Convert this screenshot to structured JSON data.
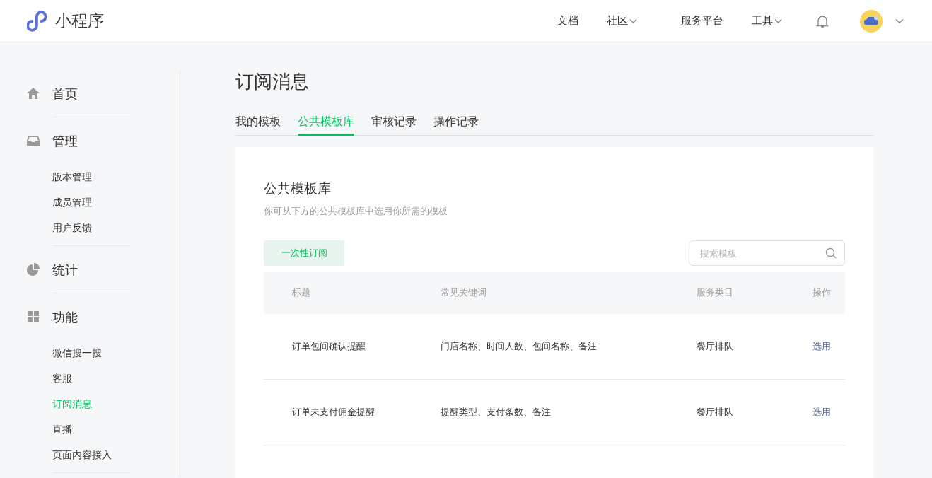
{
  "header": {
    "logo_text": "小程序",
    "nav": [
      {
        "label": "文档",
        "dropdown": false
      },
      {
        "label": "社区",
        "dropdown": true
      },
      {
        "label": "服务平台",
        "dropdown": false
      },
      {
        "label": "工具",
        "dropdown": true
      }
    ]
  },
  "sidebar": {
    "sections": [
      {
        "label": "首页",
        "kind": "home"
      },
      {
        "label": "管理",
        "kind": "inbox",
        "items": [
          {
            "label": "版本管理",
            "selected": false
          },
          {
            "label": "成员管理",
            "selected": false
          },
          {
            "label": "用户反馈",
            "selected": false
          }
        ]
      },
      {
        "label": "统计",
        "kind": "pie"
      },
      {
        "label": "功能",
        "kind": "grid",
        "items": [
          {
            "label": "微信搜一搜",
            "selected": false
          },
          {
            "label": "客服",
            "selected": false
          },
          {
            "label": "订阅消息",
            "selected": true
          },
          {
            "label": "直播",
            "selected": false
          },
          {
            "label": "页面内容接入",
            "selected": false
          }
        ]
      }
    ]
  },
  "page_title": "订阅消息",
  "tabs": [
    {
      "label": "我的模板",
      "selected": false
    },
    {
      "label": "公共模板库",
      "selected": true
    },
    {
      "label": "审核记录",
      "selected": false
    },
    {
      "label": "操作记录",
      "selected": false
    }
  ],
  "panel": {
    "title": "公共模板库",
    "subtitle": "你可从下方的公共模板库中选用你所需的模板",
    "filter_button": "一次性订阅",
    "search": {
      "placeholder": "搜索模板"
    },
    "table": {
      "columns": [
        "标题",
        "常见关键词",
        "服务类目",
        "操作"
      ],
      "rows": [
        {
          "title": "订单包间确认提醒",
          "keywords": "门店名称、时间人数、包间名称、备注",
          "category": "餐厅排队",
          "action": "选用"
        },
        {
          "title": "订单未支付佣金提醒",
          "keywords": "提醒类型、支付条数、备注",
          "category": "餐厅排队",
          "action": "选用"
        }
      ]
    }
  }
}
